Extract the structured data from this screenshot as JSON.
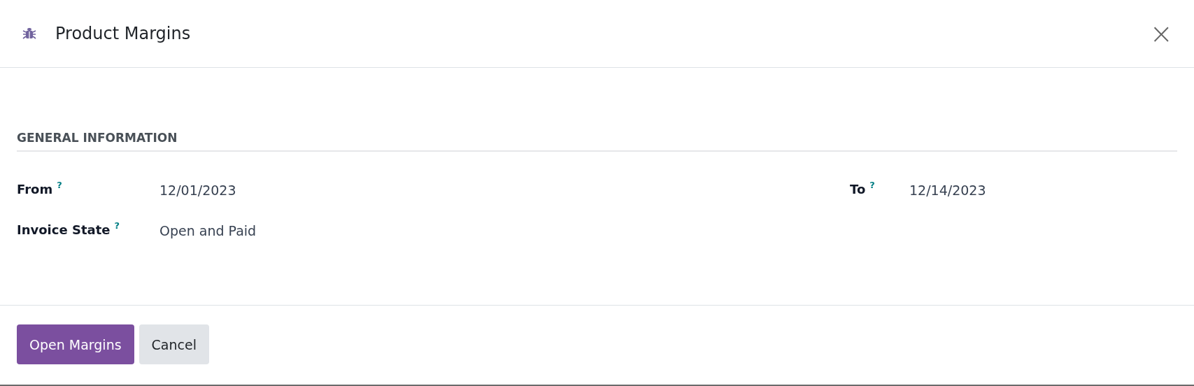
{
  "dialog": {
    "title": "Product Margins",
    "close": "×"
  },
  "section": {
    "title": "GENERAL INFORMATION"
  },
  "rows": [
    [
      {
        "label": "From",
        "help": "?",
        "value": "12/01/2023"
      },
      {
        "label": "To",
        "help": "?",
        "value": "12/14/2023"
      }
    ],
    [
      {
        "label": "Invoice State",
        "help": "?",
        "value": "Open and Paid"
      }
    ]
  ],
  "buttons": [
    {
      "label": "Open Margins",
      "kind": "primary"
    },
    {
      "label": "Cancel",
      "kind": "secondary"
    }
  ]
}
